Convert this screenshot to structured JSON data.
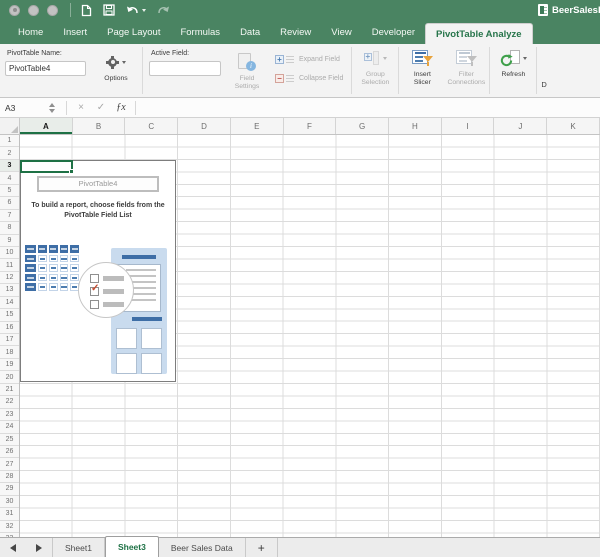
{
  "titlebar": {
    "traffic_lights": [
      "close",
      "minimize",
      "zoom"
    ],
    "quick_access": [
      "new-workbook",
      "save",
      "undo",
      "redo"
    ],
    "document_title": "BeerSalesD"
  },
  "ribbon_tabs": {
    "items": [
      "Home",
      "Insert",
      "Page Layout",
      "Formulas",
      "Data",
      "Review",
      "View",
      "Developer",
      "PivotTable Analyze"
    ],
    "active": "PivotTable Analyze"
  },
  "ribbon": {
    "pivot_name": {
      "label": "PivotTable Name:",
      "value": "PivotTable4"
    },
    "options": {
      "label": "Options",
      "enabled": true
    },
    "active_field": {
      "label": "Active Field:",
      "value": ""
    },
    "field_settings": {
      "label1": "Field",
      "label2": "Settings",
      "enabled": false
    },
    "expand_field": {
      "label": "Expand Field",
      "enabled": false
    },
    "collapse_field": {
      "label": "Collapse Field",
      "enabled": false
    },
    "group_selection": {
      "label1": "Group",
      "label2": "Selection",
      "enabled": false
    },
    "insert_slicer": {
      "label1": "Insert",
      "label2": "Slicer",
      "enabled": true
    },
    "filter_connections": {
      "label1": "Filter",
      "label2": "Connections",
      "enabled": false
    },
    "refresh": {
      "label": "Refresh",
      "enabled": true
    },
    "clipped_label": "D"
  },
  "formula_bar": {
    "name_box": "A3",
    "cancel_icon": "×",
    "enter_icon": "✓",
    "fx_label": "ƒx",
    "value": ""
  },
  "grid": {
    "columns": [
      "A",
      "B",
      "C",
      "D",
      "E",
      "F",
      "G",
      "H",
      "I",
      "J",
      "K"
    ],
    "selected_column": "A",
    "row_count": 33,
    "selected_row": 3,
    "selected_cell": "A3"
  },
  "pivot_placeholder": {
    "name": "PivotTable4",
    "message_line1": "To build a report, choose fields from the",
    "message_line2": "PivotTable Field List",
    "graphic": {
      "checkbox_rows": 3,
      "checked_row": 2,
      "check_symbol": "✓"
    }
  },
  "sheet_bar": {
    "tabs": [
      "Sheet1",
      "Sheet3",
      "Beer Sales Data"
    ],
    "active_tab": "Sheet3",
    "add_button": "+"
  },
  "colors": {
    "titlebar_green": "#4a8462",
    "accent_green": "#1e7145",
    "icon_blue": "#3e6ea6",
    "slicer_orange": "#e8a33c",
    "check_red": "#c64a2e",
    "ribbon_bg": "#f3f3f3"
  }
}
